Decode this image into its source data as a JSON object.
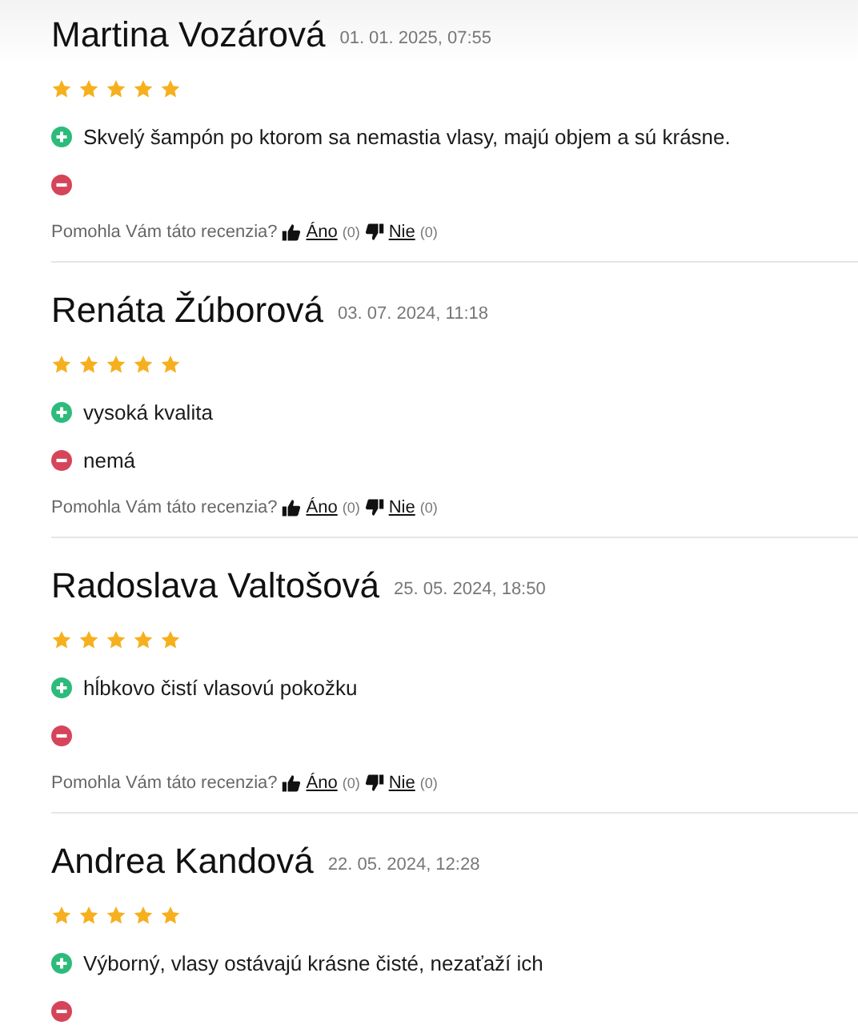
{
  "reviews": [
    {
      "name": "Martina Vozárová",
      "date": "01. 01. 2025, 07:55",
      "stars": 5,
      "pro": "Skvelý šampón po ktorom sa nemastia vlasy, majú objem a sú krásne.",
      "helpful": {
        "question": "Pomohla Vám táto recenzia?",
        "yes": "Áno",
        "yes_count": "(0)",
        "no": "Nie",
        "no_count": "(0)"
      }
    },
    {
      "name": "Renáta Žúborová",
      "date": "03. 07. 2024, 11:18",
      "stars": 5,
      "pro": "vysoká kvalita",
      "con": "nemá",
      "helpful": {
        "question": "Pomohla Vám táto recenzia?",
        "yes": "Áno",
        "yes_count": "(0)",
        "no": "Nie",
        "no_count": "(0)"
      }
    },
    {
      "name": "Radoslava Valtošová",
      "date": "25. 05. 2024, 18:50",
      "stars": 5,
      "pro": "hĺbkovo čistí vlasovú pokožku",
      "helpful": {
        "question": "Pomohla Vám táto recenzia?",
        "yes": "Áno",
        "yes_count": "(0)",
        "no": "Nie",
        "no_count": "(0)"
      }
    },
    {
      "name": "Andrea Kandová",
      "date": "22. 05. 2024, 12:28",
      "stars": 5,
      "pro": "Výborný, vlasy ostávajú krásne čisté, nezaťaží ich"
    }
  ]
}
